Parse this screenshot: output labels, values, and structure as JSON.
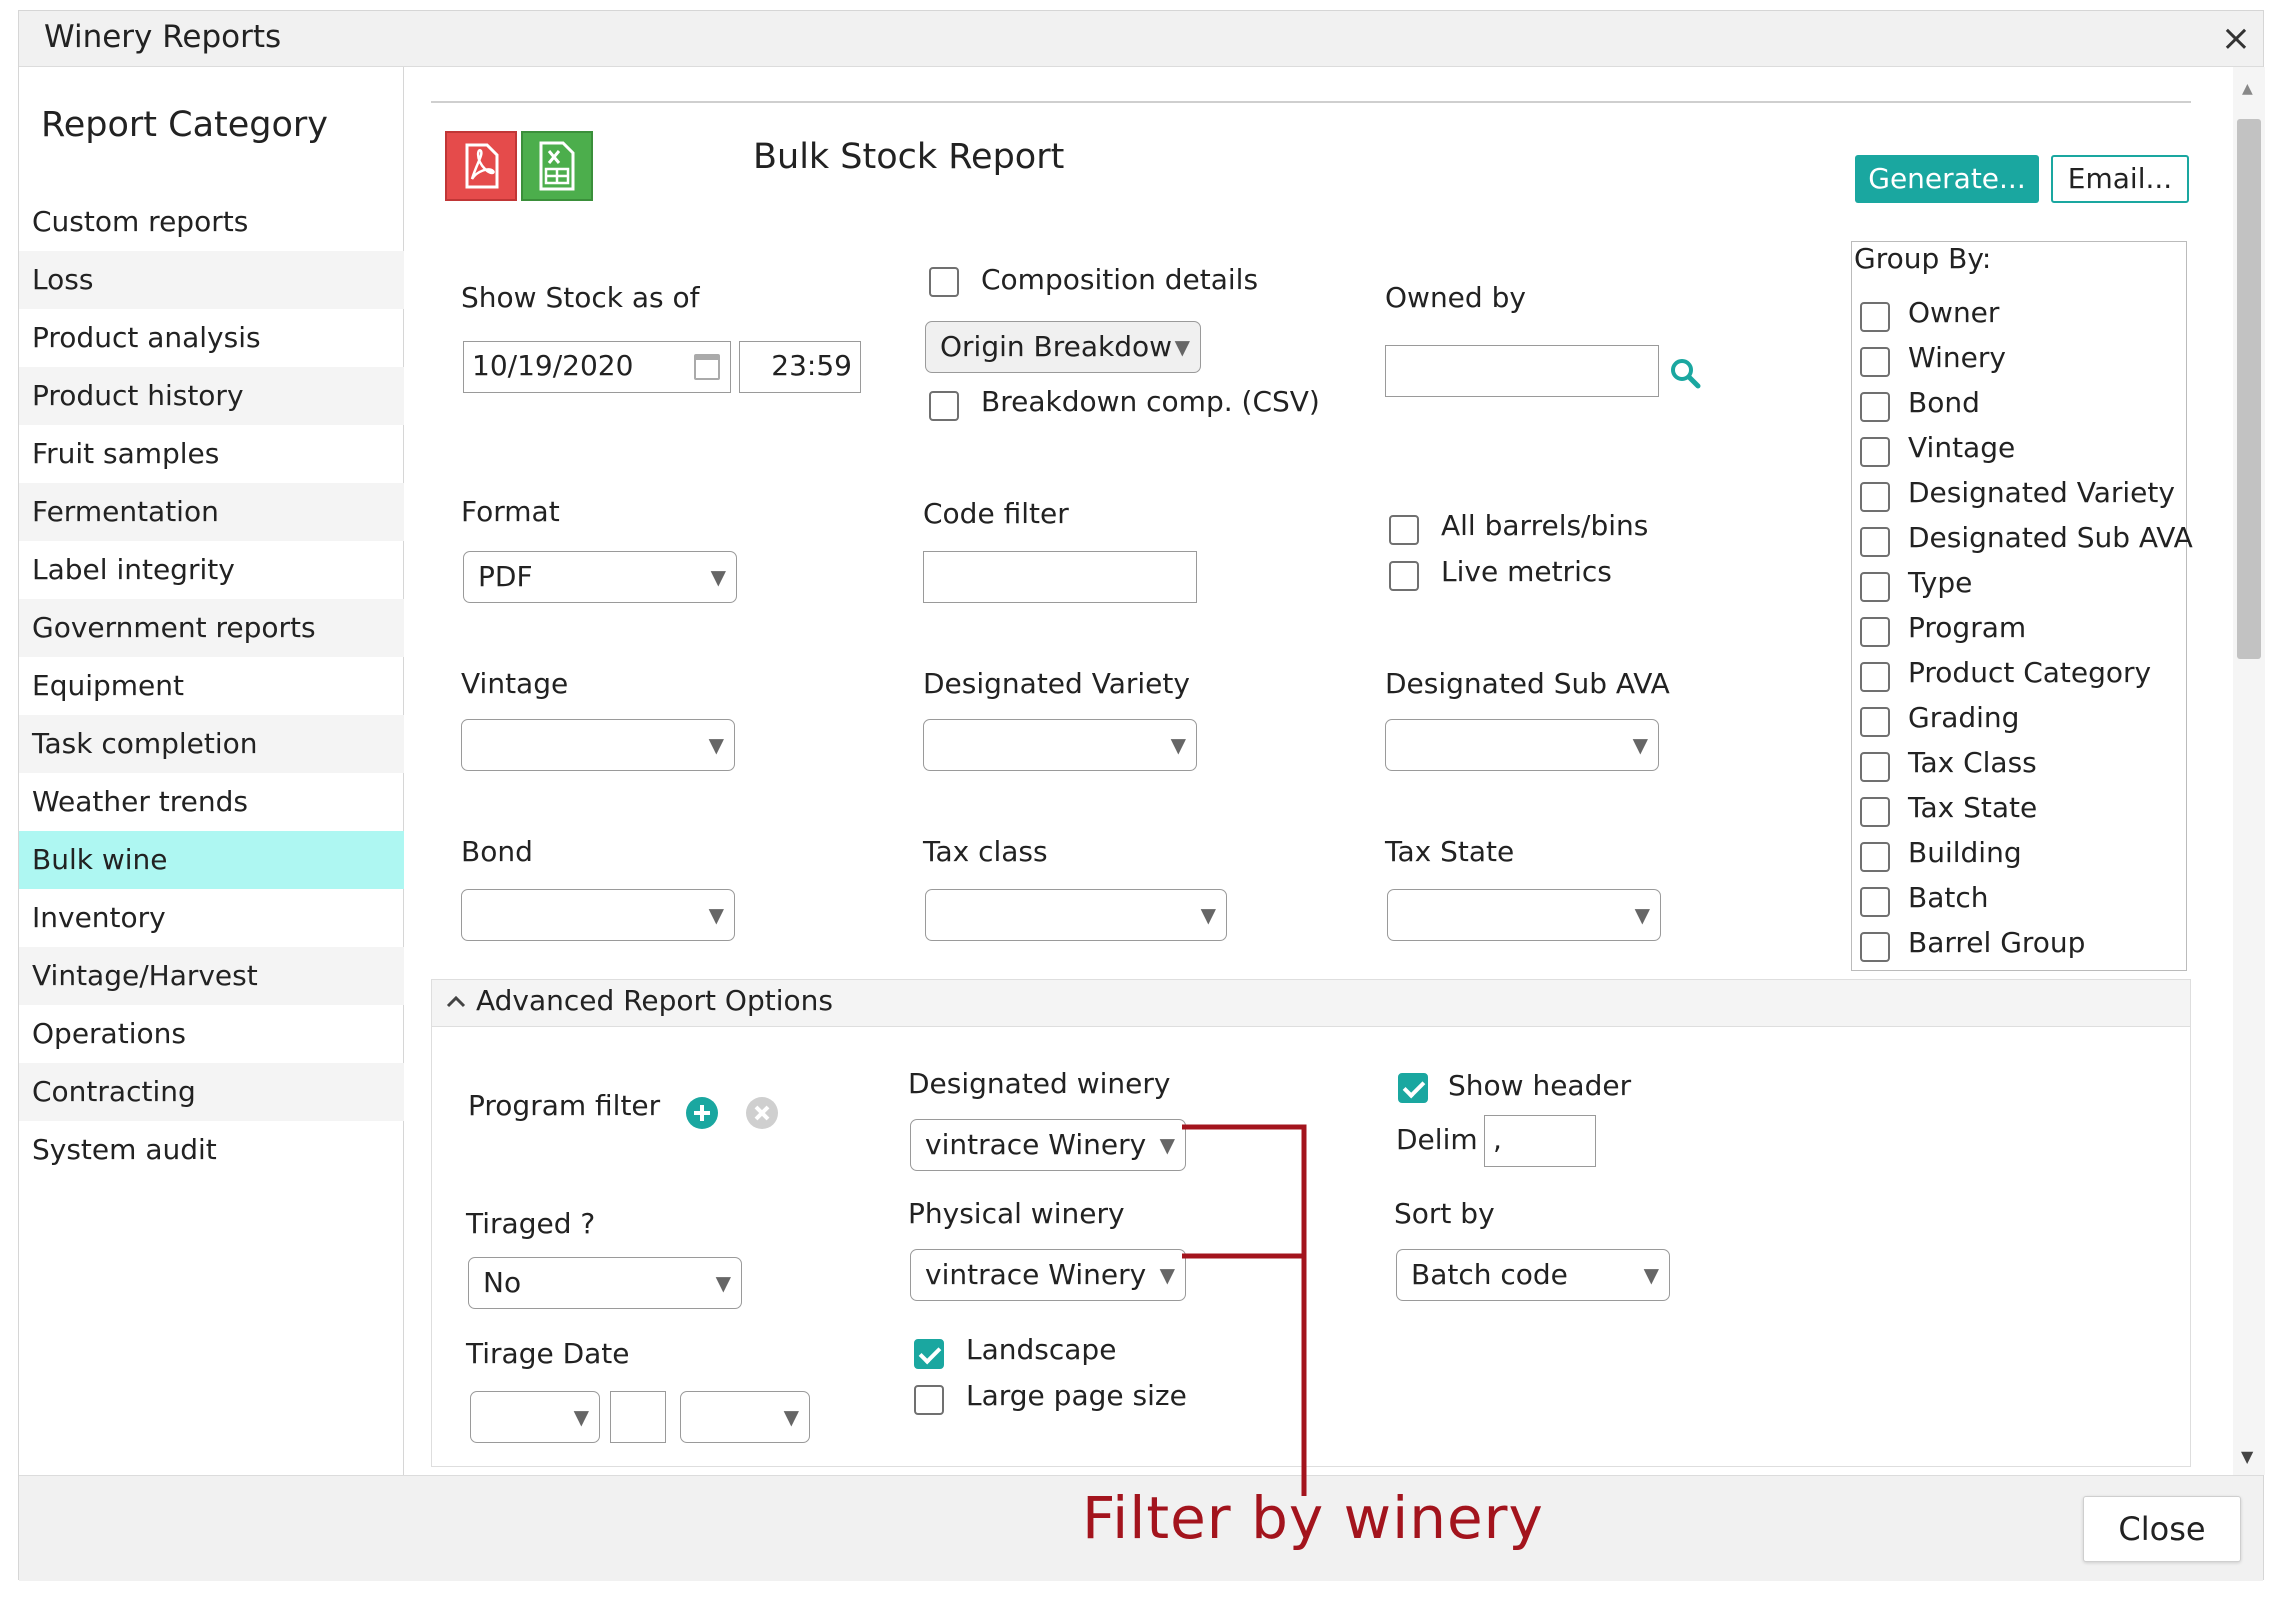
{
  "window": {
    "title": "Winery Reports",
    "close_glyph": "×"
  },
  "sidebar": {
    "heading": "Report Category",
    "items": [
      {
        "label": "Custom reports"
      },
      {
        "label": "Loss"
      },
      {
        "label": "Product analysis"
      },
      {
        "label": "Product history"
      },
      {
        "label": "Fruit samples"
      },
      {
        "label": "Fermentation"
      },
      {
        "label": "Label integrity"
      },
      {
        "label": "Government reports"
      },
      {
        "label": "Equipment"
      },
      {
        "label": "Task completion"
      },
      {
        "label": "Weather trends"
      },
      {
        "label": "Bulk wine"
      },
      {
        "label": "Inventory"
      },
      {
        "label": "Vintage/Harvest"
      },
      {
        "label": "Operations"
      },
      {
        "label": "Contracting"
      },
      {
        "label": "System audit"
      }
    ],
    "active_item": "Bulk wine",
    "active_color": "#aef7f2"
  },
  "report": {
    "title": "Bulk Stock Report",
    "pdf_icon": "pdf-icon",
    "excel_icon": "excel-icon",
    "generate_label": "Generate...",
    "email_label": "Email...",
    "accent_color": "#1aa7a0"
  },
  "form": {
    "show_stock_label": "Show Stock as of",
    "date_value": "10/19/2020",
    "time_value": "23:59",
    "composition_label": "Composition details",
    "origin_breakdown_value": "Origin Breakdow",
    "breakdown_csv_label": "Breakdown comp. (CSV)",
    "owned_by_label": "Owned by",
    "format_label": "Format",
    "format_value": "PDF",
    "code_filter_label": "Code filter",
    "all_barrels_label": "All barrels/bins",
    "live_metrics_label": "Live metrics",
    "vintage_label": "Vintage",
    "designated_variety_label": "Designated Variety",
    "designated_sub_ava_label": "Designated Sub AVA",
    "bond_label": "Bond",
    "tax_class_label": "Tax class",
    "tax_state_label": "Tax State"
  },
  "group_by": {
    "title": "Group By:",
    "options": [
      {
        "label": "Owner"
      },
      {
        "label": "Winery"
      },
      {
        "label": "Bond"
      },
      {
        "label": "Vintage"
      },
      {
        "label": "Designated Variety"
      },
      {
        "label": "Designated Sub AVA"
      },
      {
        "label": "Type"
      },
      {
        "label": "Program"
      },
      {
        "label": "Product Category"
      },
      {
        "label": "Grading"
      },
      {
        "label": "Tax Class"
      },
      {
        "label": "Tax State"
      },
      {
        "label": "Building"
      },
      {
        "label": "Batch"
      },
      {
        "label": "Barrel Group"
      }
    ]
  },
  "advanced": {
    "header": "Advanced Report Options",
    "program_filter_label": "Program filter",
    "tiraged_label": "Tiraged ?",
    "tiraged_value": "No",
    "tirage_date_label": "Tirage Date",
    "designated_winery_label": "Designated winery",
    "designated_winery_value": "vintrace Winery",
    "physical_winery_label": "Physical winery",
    "physical_winery_value": "vintrace Winery",
    "landscape_label": "Landscape",
    "large_page_label": "Large page size",
    "show_header_label": "Show header",
    "delim_label": "Delim",
    "delim_value": ",",
    "sort_by_label": "Sort by",
    "sort_by_value": "Batch code"
  },
  "footer": {
    "close_label": "Close"
  },
  "annotation": {
    "text": "Filter by winery",
    "color": "#a3141d"
  },
  "icons": {
    "calendar": "calendar-icon",
    "search": "search-icon",
    "add": "plus-circle-icon",
    "clear": "x-circle-icon",
    "dropdown": "▼",
    "collapse": "chevron-up-icon",
    "scroll_up": "▲",
    "scroll_down": "▼"
  }
}
